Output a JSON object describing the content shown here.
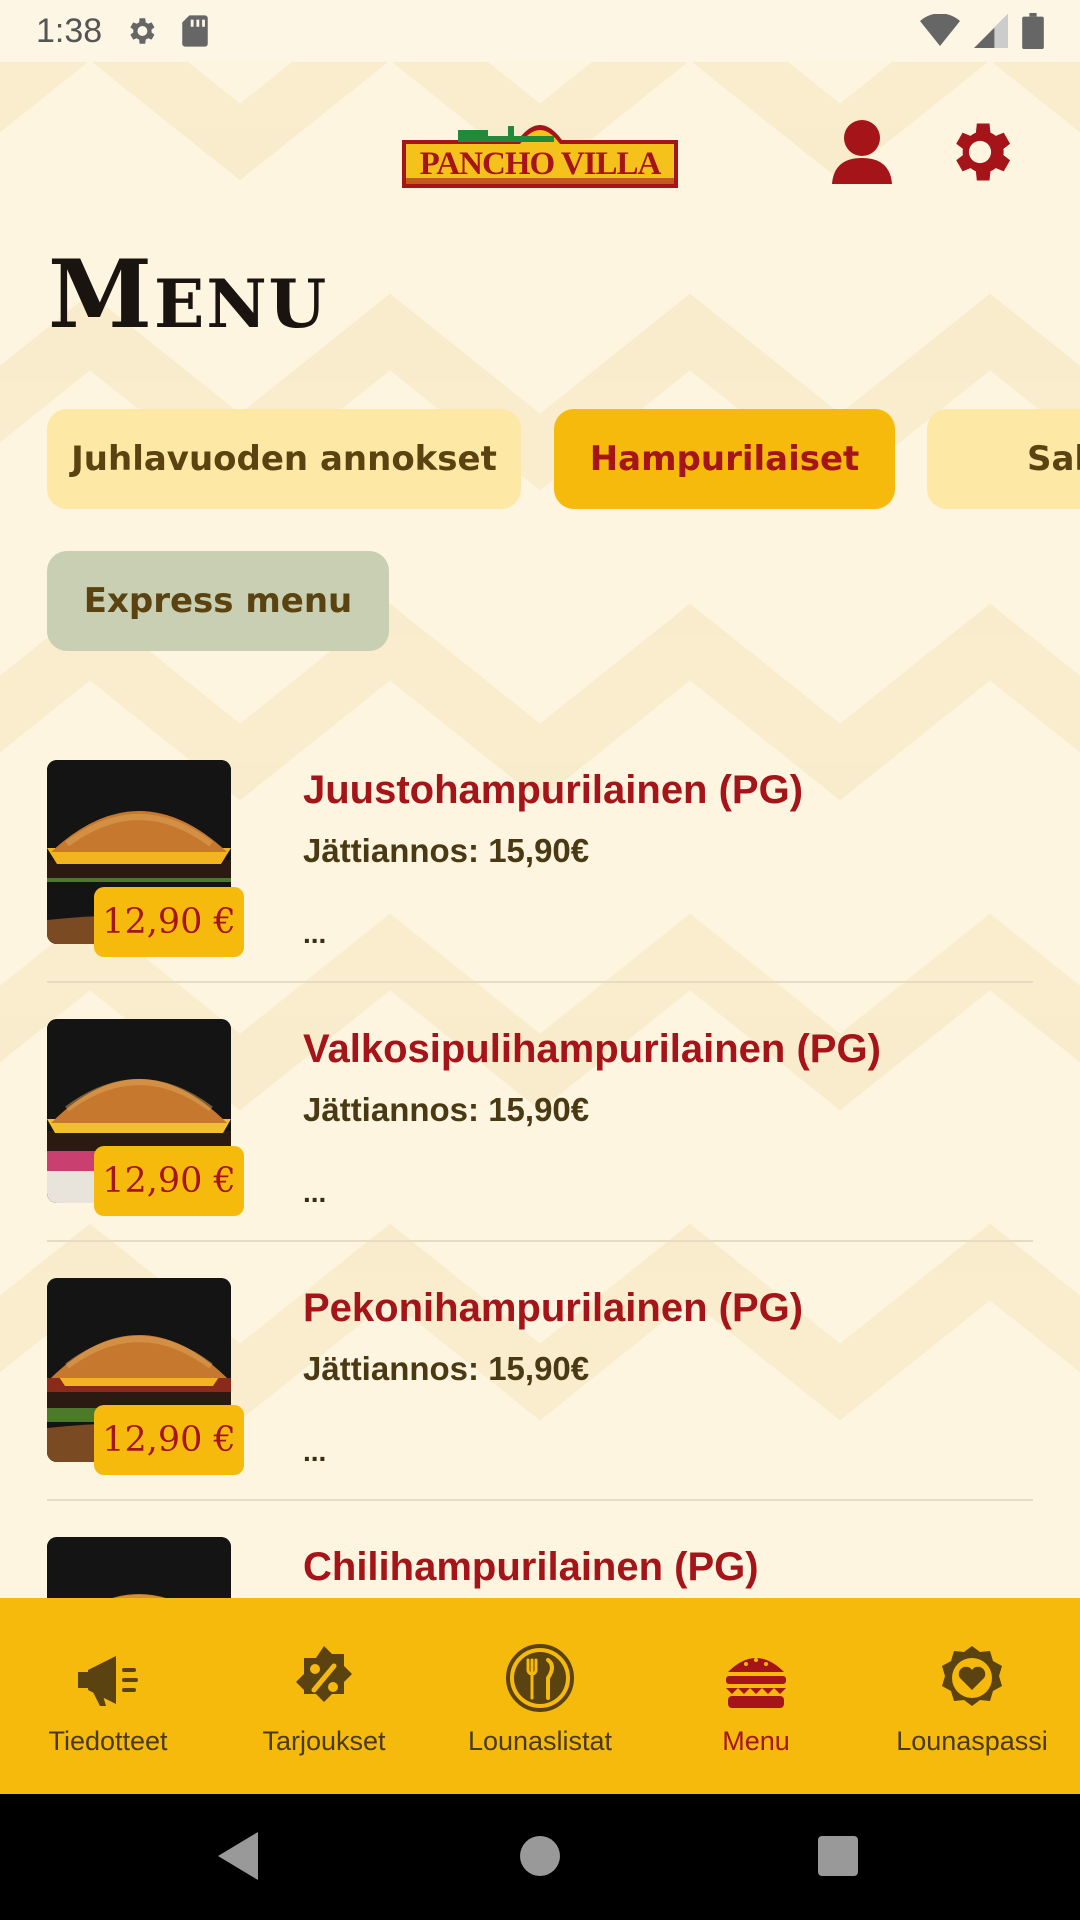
{
  "status_bar": {
    "time": "1:38",
    "icons": [
      "gear-icon",
      "sd-card-icon",
      "wifi-icon",
      "signal-icon",
      "battery-icon"
    ]
  },
  "header": {
    "logo_text": "PANCHO VILLA",
    "profile_icon": "person-icon",
    "settings_icon": "gear-icon"
  },
  "page": {
    "title": "Menu"
  },
  "categories": [
    {
      "label": "Juhlavuoden annokset",
      "selected": false
    },
    {
      "label": "Hampurilaiset",
      "selected": true
    },
    {
      "label": "Sal",
      "selected": false
    },
    {
      "label": "Express menu",
      "selected": false
    }
  ],
  "items": [
    {
      "name": "Juustohampurilainen (PG)",
      "subtitle": "Jättiannos: 15,90€",
      "price": "12,90 €",
      "more": "..."
    },
    {
      "name": "Valkosipulihampurilainen (PG)",
      "subtitle": "Jättiannos: 15,90€",
      "price": "12,90 €",
      "more": "..."
    },
    {
      "name": "Pekonihampurilainen (PG)",
      "subtitle": "Jättiannos: 15,90€",
      "price": "12,90 €",
      "more": "..."
    },
    {
      "name": "Chilihampurilainen (PG)"
    }
  ],
  "bottom_nav": [
    {
      "label": "Tiedotteet",
      "icon": "megaphone-icon"
    },
    {
      "label": "Tarjoukset",
      "icon": "discount-badge-icon"
    },
    {
      "label": "Lounaslistat",
      "icon": "plate-cutlery-icon"
    },
    {
      "label": "Menu",
      "icon": "burger-icon",
      "active": true
    },
    {
      "label": "Lounaspassi",
      "icon": "heart-badge-icon"
    }
  ],
  "colors": {
    "brand_red": "#a41419",
    "accent_yellow": "#f5ba0b",
    "chip_light": "#fde8a5",
    "chip_express": "#c8cfb2",
    "background": "#fdf5e0"
  }
}
